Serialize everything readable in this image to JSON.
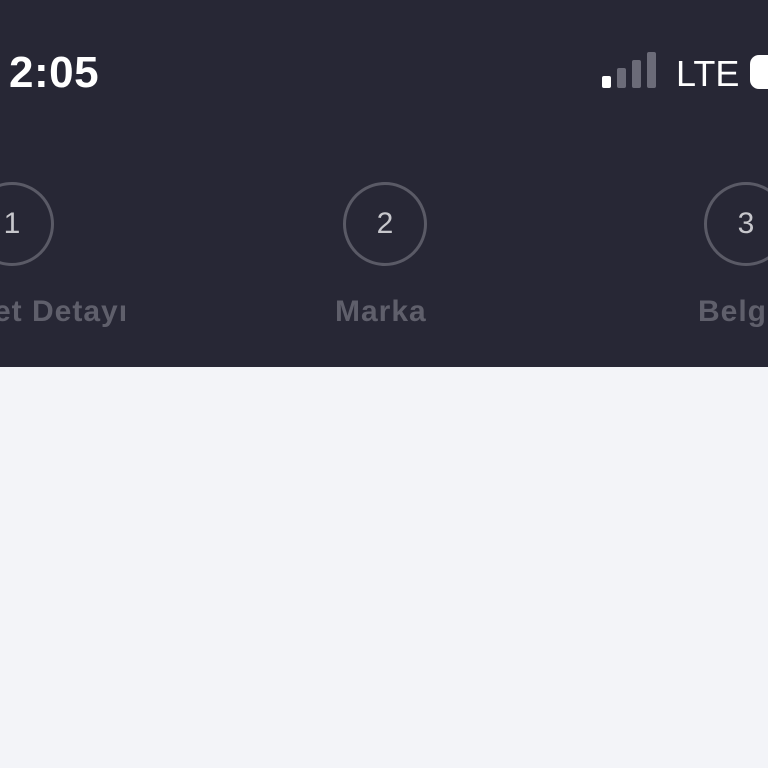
{
  "status_bar": {
    "time": "2:05",
    "network": "LTE",
    "signal_icon": "cellular-signal-icon",
    "battery_icon": "battery-icon"
  },
  "colors": {
    "header_bg": "#272735",
    "content_bg": "#f3f4f8",
    "step_border": "#5a5a66",
    "step_label": "#5f5f6b"
  },
  "steps": [
    {
      "number": "1",
      "label": "et Detayı"
    },
    {
      "number": "2",
      "label": "Marka"
    },
    {
      "number": "3",
      "label": "Belg"
    }
  ]
}
